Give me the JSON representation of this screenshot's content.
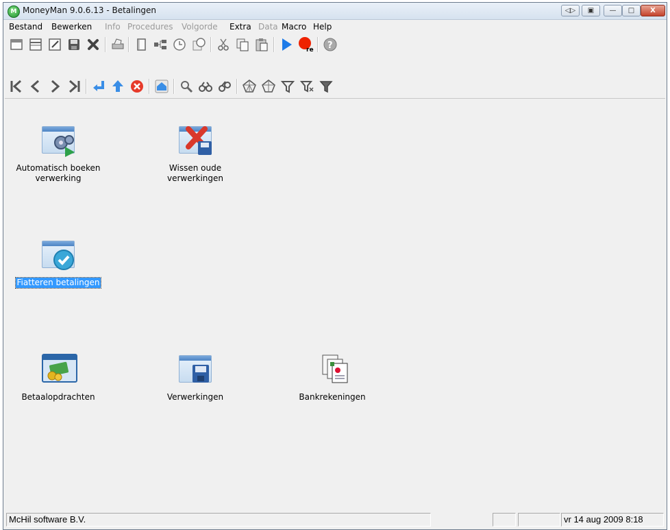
{
  "window": {
    "title": "MoneyMan 9.0.6.13 - Betalingen",
    "app_icon_letter": "M"
  },
  "title_controls": {
    "nav": "◁▷",
    "restore_doc": "▣",
    "minimize": "—",
    "maximize": "□",
    "close": "X"
  },
  "menu": [
    {
      "label": "Bestand",
      "enabled": true
    },
    {
      "label": "Bewerken",
      "enabled": true
    },
    {
      "label": "Info",
      "enabled": false
    },
    {
      "label": "Procedures",
      "enabled": false
    },
    {
      "label": "Volgorde",
      "enabled": false
    },
    {
      "label": "Extra",
      "enabled": true
    },
    {
      "label": "Data",
      "enabled": false
    },
    {
      "label": "Macro",
      "enabled": true
    },
    {
      "label": "Help",
      "enabled": true
    }
  ],
  "toolbar1": {
    "icons": [
      "new-icon",
      "window-icon",
      "edit-icon",
      "save-icon",
      "delete-icon",
      "print-icon",
      "notebook-icon",
      "tree-icon",
      "clock-check-icon",
      "clock-note-icon",
      "cut-icon",
      "copy-icon",
      "paste-icon",
      "play-icon",
      "record-icon",
      "help-icon"
    ],
    "record_label": "rec",
    "help_label": "?"
  },
  "toolbar2": {
    "icons": [
      "first-icon",
      "previous-icon",
      "next-icon",
      "last-icon",
      "enter-icon",
      "up-icon",
      "cancel-icon",
      "home-icon",
      "search-icon",
      "binoculars-icon",
      "binoculars-advanced-icon",
      "web-icon",
      "web-advanced-icon",
      "filter-icon",
      "filter-remove-icon",
      "filter-active-icon"
    ]
  },
  "launchers": [
    {
      "label_line1": "Automatisch boeken",
      "label_line2": "verwerking",
      "icon": "auto-process-icon",
      "selected": false
    },
    {
      "label_line1": "Wissen oude",
      "label_line2": "verwerkingen",
      "icon": "delete-old-icon",
      "selected": false
    },
    {
      "label_line1": "Fiatteren betalingen",
      "label_line2": "",
      "icon": "approve-payments-icon",
      "selected": true
    },
    {
      "label_line1": "Betaalopdrachten",
      "label_line2": "",
      "icon": "payment-orders-icon",
      "selected": false
    },
    {
      "label_line1": "Verwerkingen",
      "label_line2": "",
      "icon": "processings-icon",
      "selected": false
    },
    {
      "label_line1": "Bankrekeningen",
      "label_line2": "",
      "icon": "bank-accounts-icon",
      "selected": false
    }
  ],
  "statusbar": {
    "company": "McHil software B.V.",
    "cell2": "",
    "cell3": "",
    "datetime": "vr 14 aug 2009 8:18"
  }
}
